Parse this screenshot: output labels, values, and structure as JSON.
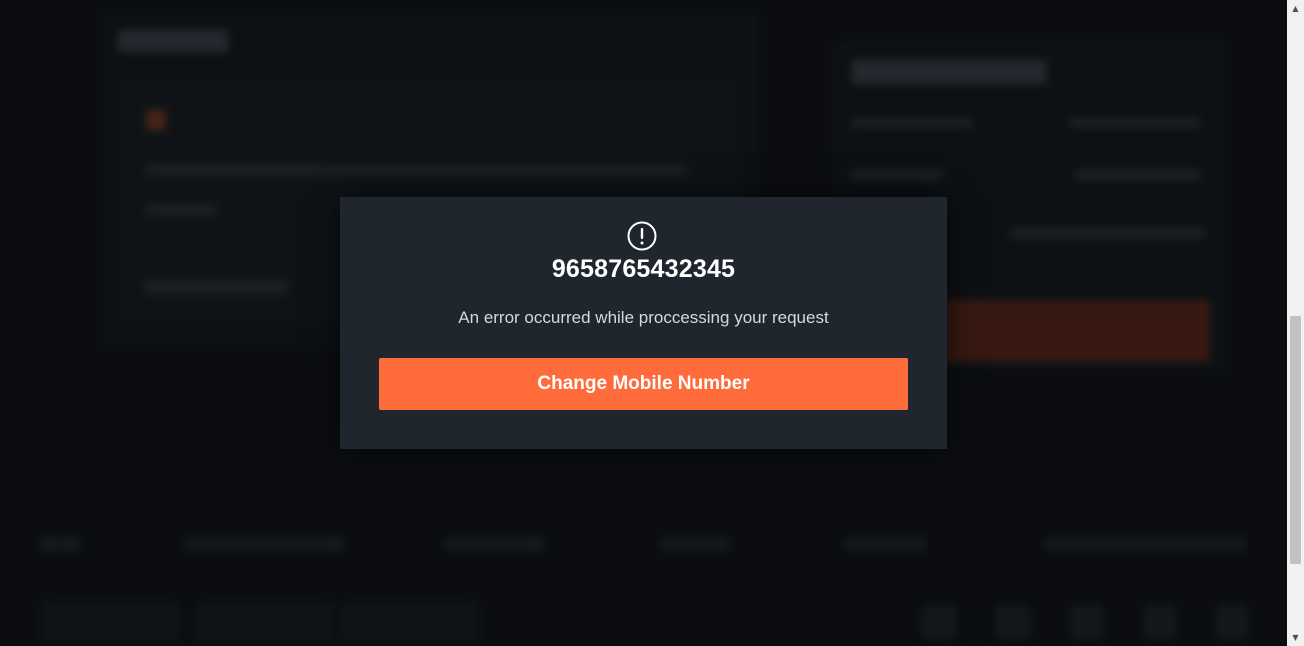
{
  "modal": {
    "icon": "exclamation-circle-icon",
    "title": "9658765432345",
    "message": "An error occurred while proccessing your request",
    "button_label": "Change Mobile Number"
  },
  "colors": {
    "accent": "#ff6b3a",
    "modal_background": "#1f262d",
    "page_background": "#0b0d10"
  },
  "scrollbar": {
    "up_arrow": "▲",
    "down_arrow": "▼"
  }
}
